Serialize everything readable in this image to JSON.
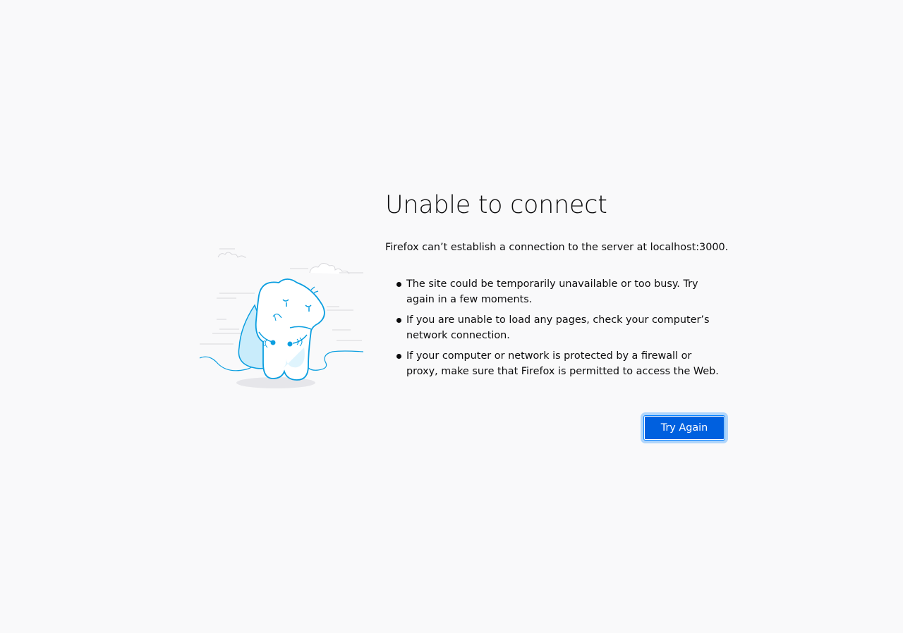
{
  "error": {
    "title": "Unable to connect",
    "description": "Firefox can’t establish a connection to the server at localhost:3000.",
    "reasons": [
      "The site could be temporarily unavailable or too busy. Try again in a few moments.",
      "If you are unable to load any pages, check your computer’s network connection.",
      "If your computer or network is protected by a firewall or proxy, make sure that Firefox is permitted to access the Web."
    ],
    "try_again_label": "Try Again"
  },
  "illustration": {
    "icon": "disconnected-dino-icon"
  },
  "colors": {
    "background": "#f9f9fa",
    "accent": "#0060df",
    "illustration_line": "#0a9ee0"
  }
}
